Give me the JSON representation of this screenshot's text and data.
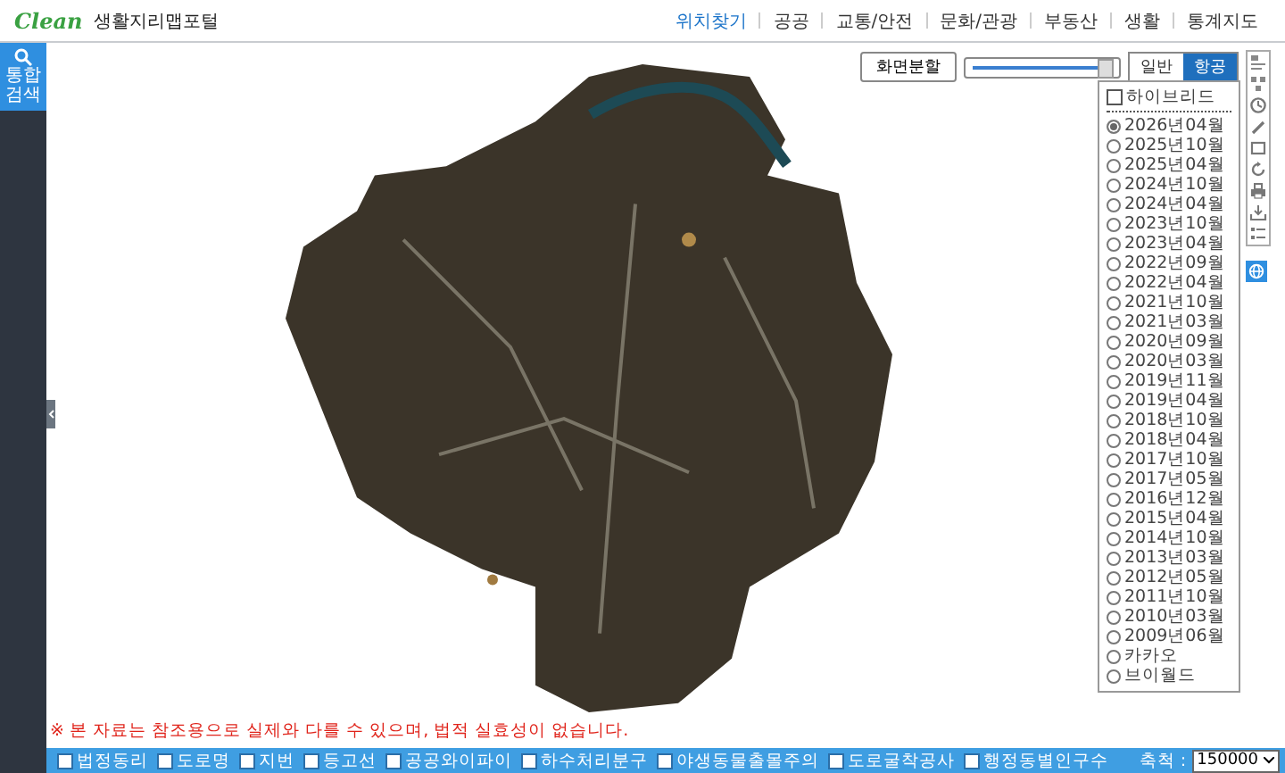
{
  "header": {
    "logo": "Clean",
    "title": "생활지리맵포털",
    "nav": [
      {
        "label": "위치찾기",
        "selected": true
      },
      {
        "label": "공공",
        "selected": false
      },
      {
        "label": "교통/안전",
        "selected": false
      },
      {
        "label": "문화/관광",
        "selected": false
      },
      {
        "label": "부동산",
        "selected": false
      },
      {
        "label": "생활",
        "selected": false
      },
      {
        "label": "통계지도",
        "selected": false
      }
    ]
  },
  "sidebar": {
    "search_label": "통합검색"
  },
  "map": {
    "split_button": "화면분할",
    "opacity": {
      "level": 0.95
    },
    "base_layers": [
      {
        "label": "일반",
        "selected": false
      },
      {
        "label": "항공",
        "selected": true
      }
    ],
    "hybrid": {
      "label": "하이브리드",
      "checked": false
    },
    "imagery": [
      {
        "label": "2026년04월",
        "selected": true
      },
      {
        "label": "2025년10월",
        "selected": false
      },
      {
        "label": "2025년04월",
        "selected": false
      },
      {
        "label": "2024년10월",
        "selected": false
      },
      {
        "label": "2024년04월",
        "selected": false
      },
      {
        "label": "2023년10월",
        "selected": false
      },
      {
        "label": "2023년04월",
        "selected": false
      },
      {
        "label": "2022년09월",
        "selected": false
      },
      {
        "label": "2022년04월",
        "selected": false
      },
      {
        "label": "2021년10월",
        "selected": false
      },
      {
        "label": "2021년03월",
        "selected": false
      },
      {
        "label": "2020년09월",
        "selected": false
      },
      {
        "label": "2020년03월",
        "selected": false
      },
      {
        "label": "2019년11월",
        "selected": false
      },
      {
        "label": "2019년04월",
        "selected": false
      },
      {
        "label": "2018년10월",
        "selected": false
      },
      {
        "label": "2018년04월",
        "selected": false
      },
      {
        "label": "2017년10월",
        "selected": false
      },
      {
        "label": "2017년05월",
        "selected": false
      },
      {
        "label": "2016년12월",
        "selected": false
      },
      {
        "label": "2015년04월",
        "selected": false
      },
      {
        "label": "2014년10월",
        "selected": false
      },
      {
        "label": "2013년03월",
        "selected": false
      },
      {
        "label": "2012년05월",
        "selected": false
      },
      {
        "label": "2011년10월",
        "selected": false
      },
      {
        "label": "2010년03월",
        "selected": false
      },
      {
        "label": "2009년06월",
        "selected": false
      },
      {
        "label": "카카오",
        "selected": false
      },
      {
        "label": "브이월드",
        "selected": false
      }
    ],
    "tools": [
      {
        "kind": "legend",
        "selected": false
      },
      {
        "kind": "grid",
        "selected": false
      },
      {
        "kind": "clock",
        "selected": false
      },
      {
        "kind": "pen",
        "selected": false
      },
      {
        "kind": "rect",
        "selected": false
      },
      {
        "kind": "refresh",
        "selected": false
      },
      {
        "kind": "print",
        "selected": false
      },
      {
        "kind": "download",
        "selected": false
      },
      {
        "kind": "list",
        "selected": false
      },
      {
        "kind": "globe",
        "selected": true
      }
    ],
    "notice": "※ 본 자료는 참조용으로 실제와 다를 수 있으며, 법적 실효성이 없습니다."
  },
  "bottom": {
    "layers": [
      {
        "label": "법정동리",
        "checked": false
      },
      {
        "label": "도로명",
        "checked": false
      },
      {
        "label": "지번",
        "checked": false
      },
      {
        "label": "등고선",
        "checked": false
      },
      {
        "label": "공공와이파이",
        "checked": false
      },
      {
        "label": "하수처리분구",
        "checked": false
      },
      {
        "label": "야생동물출몰주의",
        "checked": false
      },
      {
        "label": "도로굴착공사",
        "checked": false
      },
      {
        "label": "행정동별인구수",
        "checked": false
      }
    ],
    "scale_label": "축척 :",
    "scale": "150000"
  }
}
